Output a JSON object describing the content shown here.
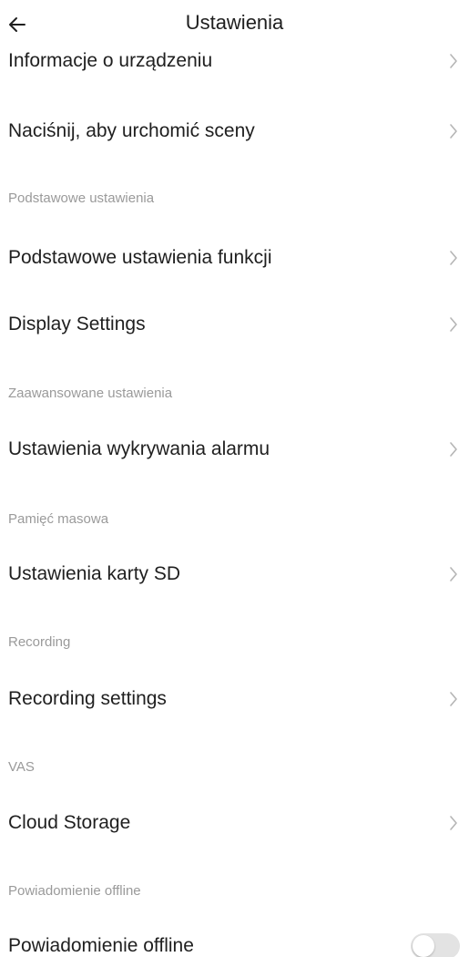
{
  "header": {
    "title": "Ustawienia",
    "back_icon": "arrow-left-icon"
  },
  "rows": {
    "device_info": "Informacje o urządzeniu",
    "tap_scenes": "Naciśnij, aby urchomić sceny",
    "basic_functions": "Podstawowe ustawienia funkcji",
    "display_settings": "Display Settings",
    "alarm_detection": "Ustawienia wykrywania alarmu",
    "sd_card": "Ustawienia karty SD",
    "recording_settings": "Recording settings",
    "cloud_storage": "Cloud Storage",
    "offline_notification": "Powiadomienie offline"
  },
  "sections": {
    "basic": "Podstawowe ustawienia",
    "advanced": "Zaawansowane ustawienia",
    "storage": "Pamięć masowa",
    "recording": "Recording",
    "vas": "VAS",
    "offline": "Powiadomienie offline"
  },
  "toggles": {
    "offline_notification_on": false
  },
  "colors": {
    "text_primary": "#1f1f1f",
    "text_section": "#9a9a9a",
    "chevron": "#b5b5b5",
    "toggle_off": "#e3e3e3",
    "background": "#ffffff"
  },
  "icons": {
    "chevron": "chevron-right-icon"
  }
}
